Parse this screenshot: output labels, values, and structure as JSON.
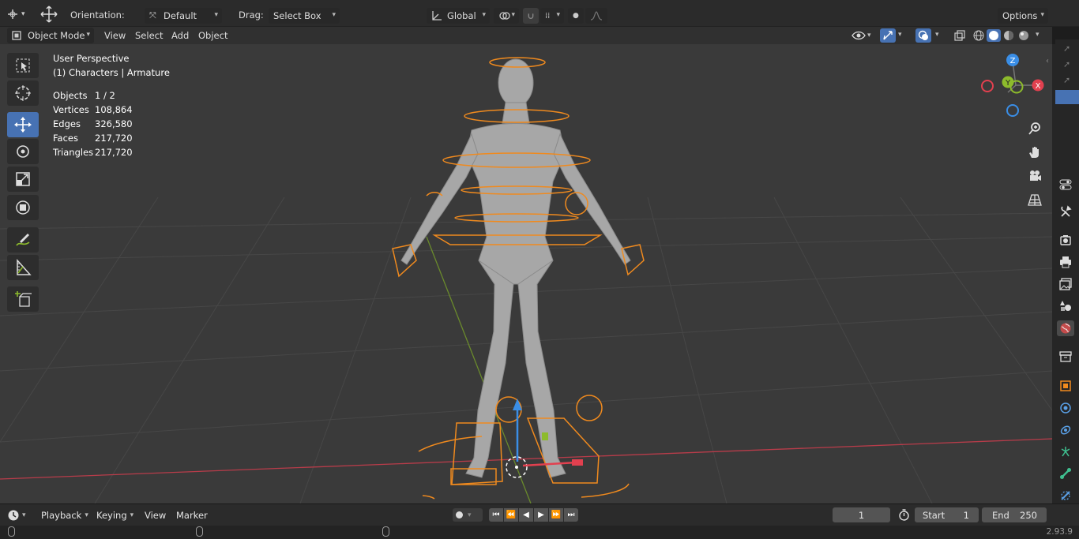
{
  "header": {
    "orientation_label": "Orientation:",
    "orientation_value": "Default",
    "drag_label": "Drag:",
    "drag_value": "Select Box",
    "transform_space": "Global",
    "options_label": "Options"
  },
  "viewport_header": {
    "mode": "Object Mode",
    "menus": [
      "View",
      "Select",
      "Add",
      "Object"
    ]
  },
  "overlay": {
    "perspective": "User Perspective",
    "collection": "(1) Characters | Armature",
    "stats": [
      {
        "label": "Objects",
        "value": "1 / 2"
      },
      {
        "label": "Vertices",
        "value": "108,864"
      },
      {
        "label": "Edges",
        "value": "326,580"
      },
      {
        "label": "Faces",
        "value": "217,720"
      },
      {
        "label": "Triangles",
        "value": "217,720"
      }
    ]
  },
  "gizmo": {
    "z": "Z",
    "y": "Y",
    "x": "X"
  },
  "toolbar": {
    "tools": [
      "select-box-tool",
      "cursor-tool",
      "move-tool",
      "rotate-tool",
      "scale-tool",
      "transform-tool",
      "annotate-tool",
      "measure-tool",
      "add-cube-tool"
    ],
    "active": "move-tool"
  },
  "timeline": {
    "menus": [
      "Playback",
      "Keying",
      "View",
      "Marker"
    ],
    "current_frame": "1",
    "start_label": "Start",
    "start_value": "1",
    "end_label": "End",
    "end_value": "250"
  },
  "status": {
    "version": "2.93.9"
  },
  "colors": {
    "accent": "#4772b3",
    "armature": "#f08a1e",
    "x_axis": "#e2404f",
    "y_axis": "#8dbb2c",
    "z_axis": "#3a8ee6",
    "viewport_bg": "#3a3a3a"
  }
}
